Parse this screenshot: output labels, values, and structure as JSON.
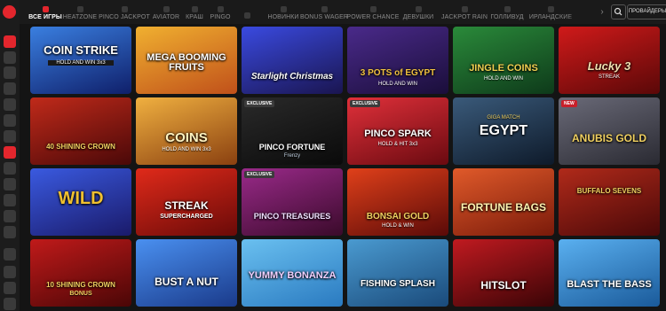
{
  "nav": {
    "tabs": [
      {
        "label": "ВСЕ ИГРЫ",
        "active": true,
        "icon": "grid-icon"
      },
      {
        "label": "HEATZONE",
        "icon": "fire-icon"
      },
      {
        "label": "PINCO JACKPOT",
        "icon": "jackpot-icon"
      },
      {
        "label": "AVIATOR",
        "icon": "plane-icon"
      },
      {
        "label": "КРАШ",
        "icon": "rocket-icon"
      },
      {
        "label": "PINGO",
        "icon": "ball-icon"
      },
      {
        "label": "",
        "icon": "star-icon"
      },
      {
        "label": "НОВИНКИ",
        "icon": "new-icon"
      },
      {
        "label": "BONUS WAGER",
        "icon": "gift-icon"
      },
      {
        "label": "POWER CHANCE",
        "icon": "bolt-icon"
      },
      {
        "label": "ДЕВУШКИ",
        "icon": "girl-icon"
      },
      {
        "label": "JACKPOT RAIN",
        "icon": "rain-icon"
      },
      {
        "label": "ГОЛЛИВУД",
        "icon": "film-icon"
      },
      {
        "label": "ИРЛАНДСКИЕ",
        "icon": "clover-icon"
      }
    ],
    "providers_label": "ПРОВАЙДЕРЫ"
  },
  "games": [
    {
      "title": "COIN STRIKE",
      "subtitle": "HOLD AND WIN 3x3",
      "badge": "",
      "bg": "#1d3f8a"
    },
    {
      "title": "MEGA BOOMING FRUITS",
      "subtitle": "",
      "badge": "",
      "bg": "#e08a1a"
    },
    {
      "title": "Starlight Christmas",
      "subtitle": "",
      "badge": "",
      "bg": "#2b2f8c"
    },
    {
      "title": "3 POTS of EGYPT",
      "subtitle": "HOLD AND WIN",
      "badge": "",
      "bg": "#2a1d5c"
    },
    {
      "title": "JINGLE COINS",
      "subtitle": "HOLD AND WIN",
      "badge": "",
      "bg": "#1f6a2d"
    },
    {
      "title": "Lucky 3",
      "subtitle": "STREAK",
      "badge": "",
      "bg": "#9b0f16"
    },
    {
      "title": "40 SHINING CROWN",
      "subtitle": "",
      "badge": "",
      "bg": "#7a1216"
    },
    {
      "title": "COINS",
      "subtitle": "HOLD AND WIN 3x3",
      "badge": "",
      "bg": "#b8741a"
    },
    {
      "title": "PINCO FORTUNE",
      "subtitle": "Frenzy",
      "badge": "EXCLUSIVE",
      "bg": "#1a1a1a"
    },
    {
      "title": "PINCO SPARK",
      "subtitle": "HOLD & HIT 3x3",
      "badge": "EXCLUSIVE",
      "bg": "#9a1822"
    },
    {
      "title": "EGYPT",
      "subtitle": "GIGA MATCH",
      "badge": "",
      "bg": "#2a3c52"
    },
    {
      "title": "ANUBIS GOLD",
      "subtitle": "",
      "badge": "NEW",
      "bg": "#4a4a55"
    },
    {
      "title": "WILD",
      "subtitle": "",
      "badge": "",
      "bg": "#2a3fa8"
    },
    {
      "title": "STREAK",
      "subtitle": "SUPERCHARGED",
      "badge": "",
      "bg": "#b31a1a"
    },
    {
      "title": "PINCO TREASURES",
      "subtitle": "",
      "badge": "EXCLUSIVE",
      "bg": "#7a1a6a"
    },
    {
      "title": "BONSAI GOLD",
      "subtitle": "HOLD & WIN",
      "badge": "",
      "bg": "#c02a1a"
    },
    {
      "title": "FORTUNE BAGS",
      "subtitle": "",
      "badge": "",
      "bg": "#c0391a"
    },
    {
      "title": "BUFFALO SEVENS",
      "subtitle": "",
      "badge": "",
      "bg": "#8a1a1a"
    },
    {
      "title": "10 SHINING CROWN",
      "subtitle": "BONUS",
      "badge": "",
      "bg": "#8a1214"
    },
    {
      "title": "BUST A NUT",
      "subtitle": "",
      "badge": "",
      "bg": "#2a6ad0"
    },
    {
      "title": "YUMMY BONANZA",
      "subtitle": "",
      "badge": "",
      "bg": "#3aa0e0"
    },
    {
      "title": "FISHING SPLASH",
      "subtitle": "",
      "badge": "",
      "bg": "#2a6aa0"
    },
    {
      "title": "HITSLOT",
      "subtitle": "",
      "badge": "",
      "bg": "#7a0e12"
    },
    {
      "title": "BLAST THE BASS",
      "subtitle": "",
      "badge": "",
      "bg": "#2a7ac0"
    }
  ]
}
